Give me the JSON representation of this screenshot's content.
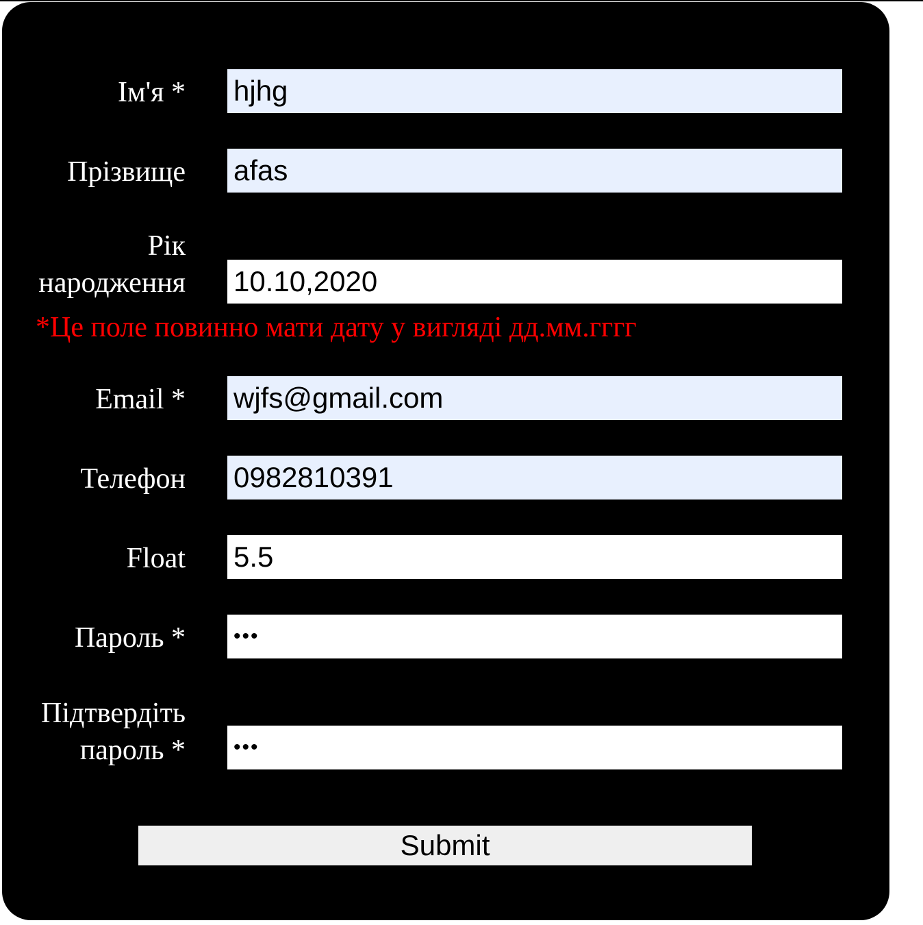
{
  "form": {
    "first_name": {
      "label": "Ім'я *",
      "value": "hjhg"
    },
    "last_name": {
      "label": "Прізвище",
      "value": "afas"
    },
    "birth_year": {
      "label": "Рік народження",
      "value": "10.10,2020",
      "error": "*Це поле повинно мати дату у вигляді дд.мм.гггг"
    },
    "email": {
      "label": "Email *",
      "value": "wjfs@gmail.com"
    },
    "phone": {
      "label": "Телефон",
      "value": "0982810391"
    },
    "float": {
      "label": "Float",
      "value": "5.5"
    },
    "password": {
      "label": "Пароль *",
      "value": "•••"
    },
    "confirm_password": {
      "label": "Підтвердіть пароль *",
      "value": "•••"
    },
    "submit_label": "Submit"
  },
  "colors": {
    "background": "#000000",
    "label_text": "#ffffff",
    "error_text": "#ff0000",
    "autofill_field": "#e8f0fe",
    "plain_field": "#ffffff",
    "button": "#efefef"
  }
}
